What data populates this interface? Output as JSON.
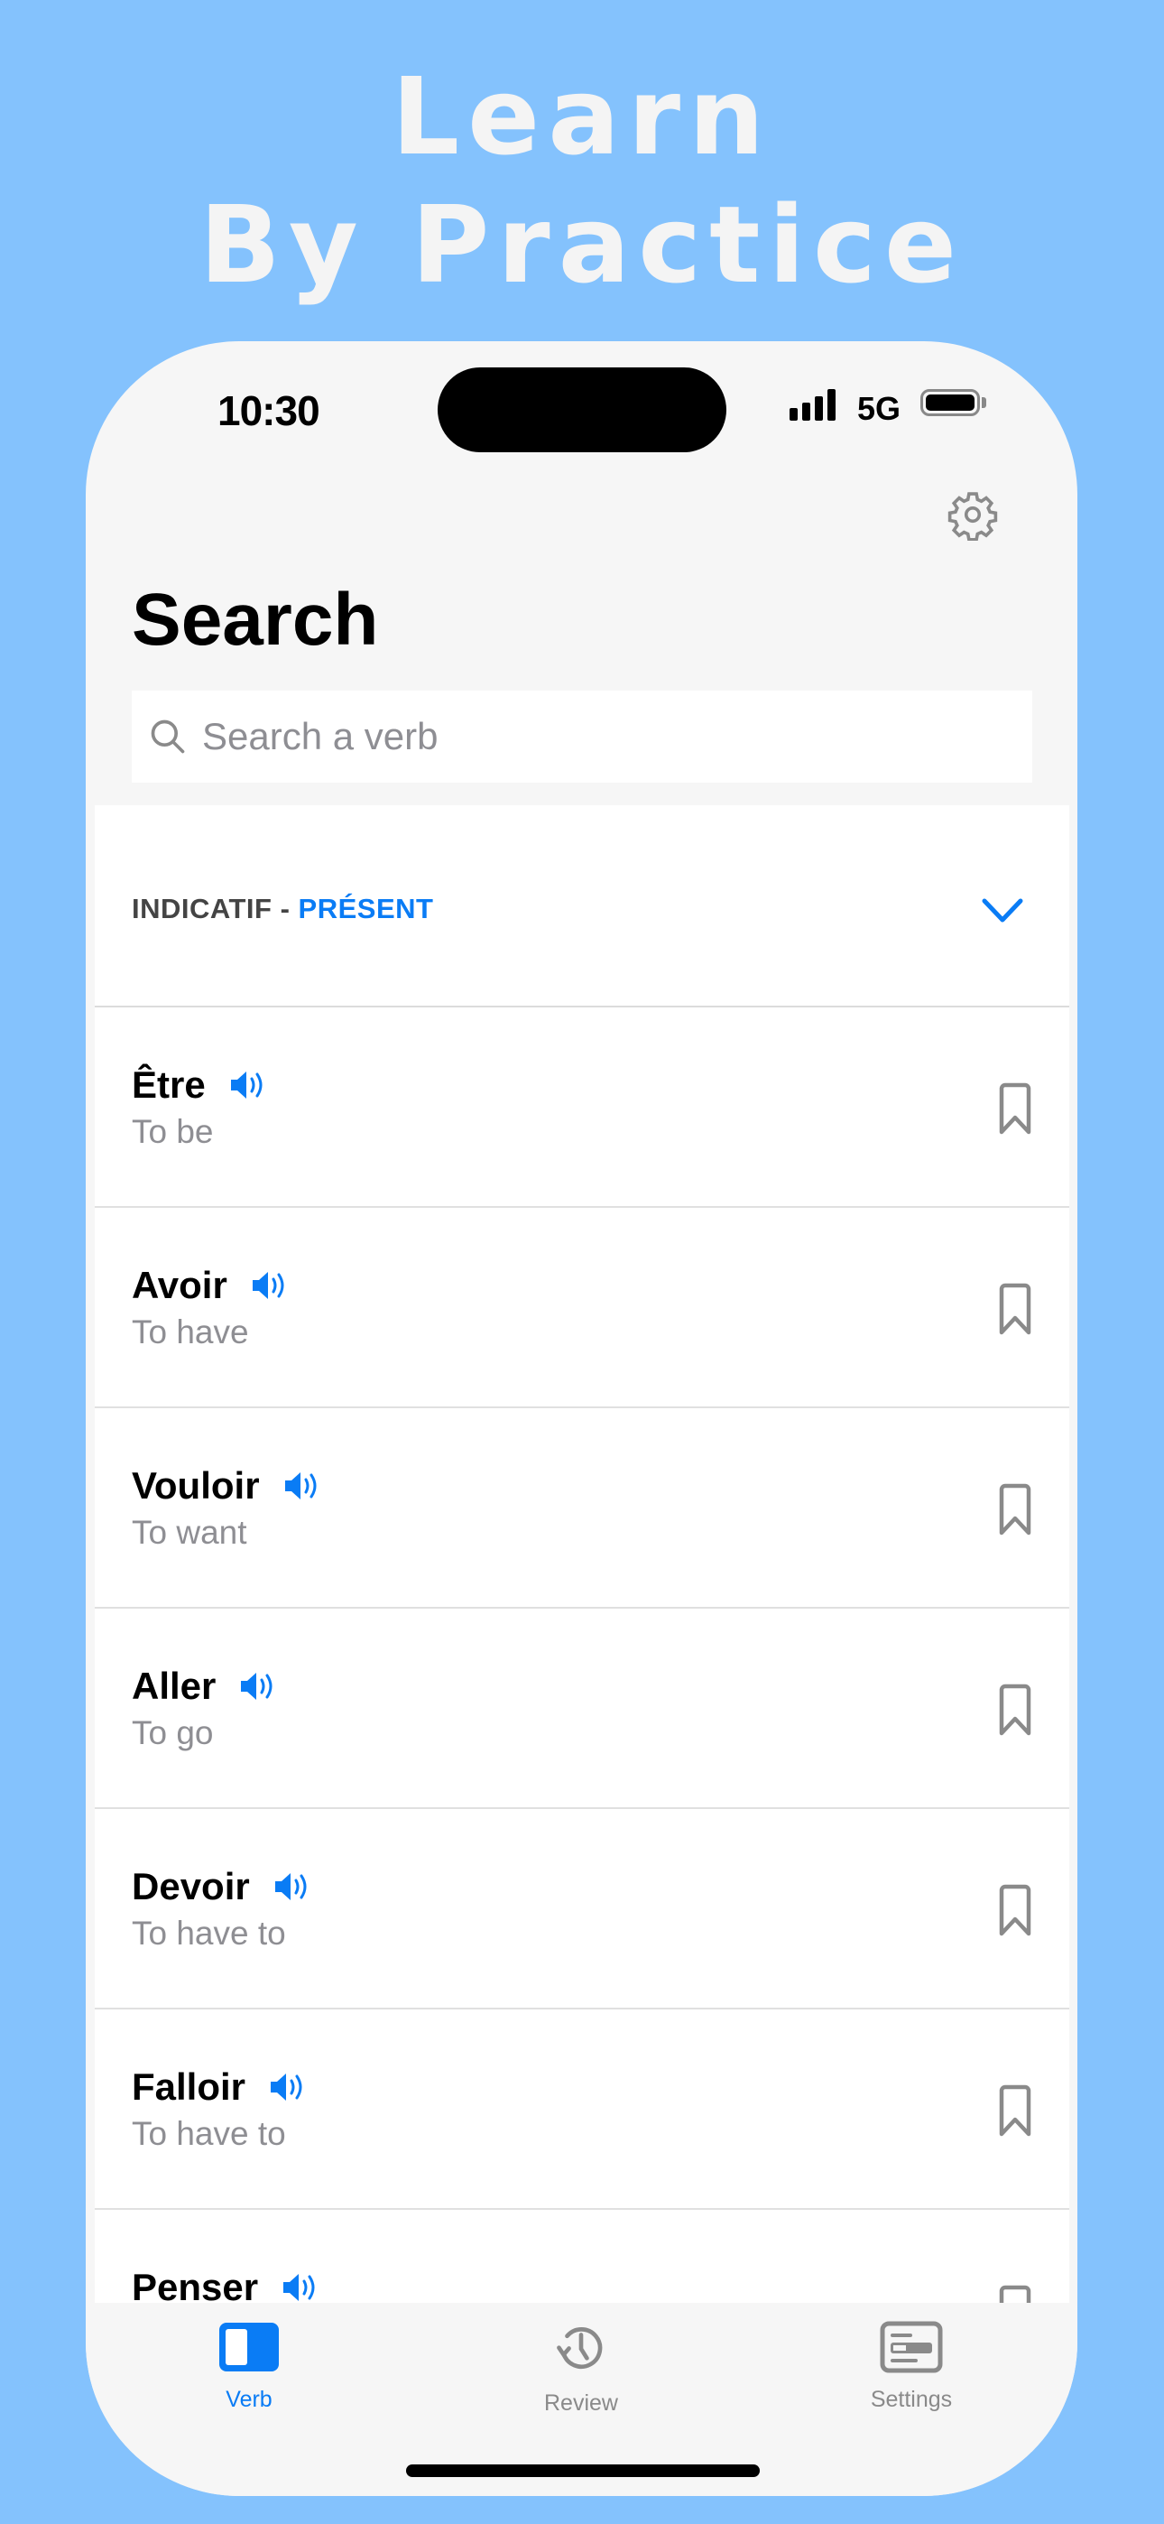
{
  "promo": {
    "line1": "Learn",
    "line2": "By Practice"
  },
  "status_bar": {
    "time": "10:30",
    "network": "5G",
    "signal_icon": "cellular-signal-icon",
    "battery_icon": "battery-icon"
  },
  "header": {
    "title": "Search",
    "settings_icon": "gear-icon"
  },
  "search": {
    "placeholder": "Search a verb",
    "value": ""
  },
  "section": {
    "mood": "INDICATIF",
    "separator": " - ",
    "tense": "PRÉSENT",
    "chevron_icon": "chevron-down-icon"
  },
  "verbs": [
    {
      "name": "Être",
      "translation": "To be"
    },
    {
      "name": "Avoir",
      "translation": "To have"
    },
    {
      "name": "Vouloir",
      "translation": "To want"
    },
    {
      "name": "Aller",
      "translation": "To go"
    },
    {
      "name": "Devoir",
      "translation": "To have to"
    },
    {
      "name": "Falloir",
      "translation": "To have to"
    },
    {
      "name": "Penser",
      "translation": ""
    }
  ],
  "tabs": [
    {
      "label": "Verb",
      "icon": "sidebar-icon",
      "active": true
    },
    {
      "label": "Review",
      "icon": "history-icon",
      "active": false
    },
    {
      "label": "Settings",
      "icon": "card-icon",
      "active": false
    }
  ],
  "colors": {
    "accent": "#0a7cf5",
    "background": "#84c2fd",
    "secondary_text": "#8e8e93"
  }
}
